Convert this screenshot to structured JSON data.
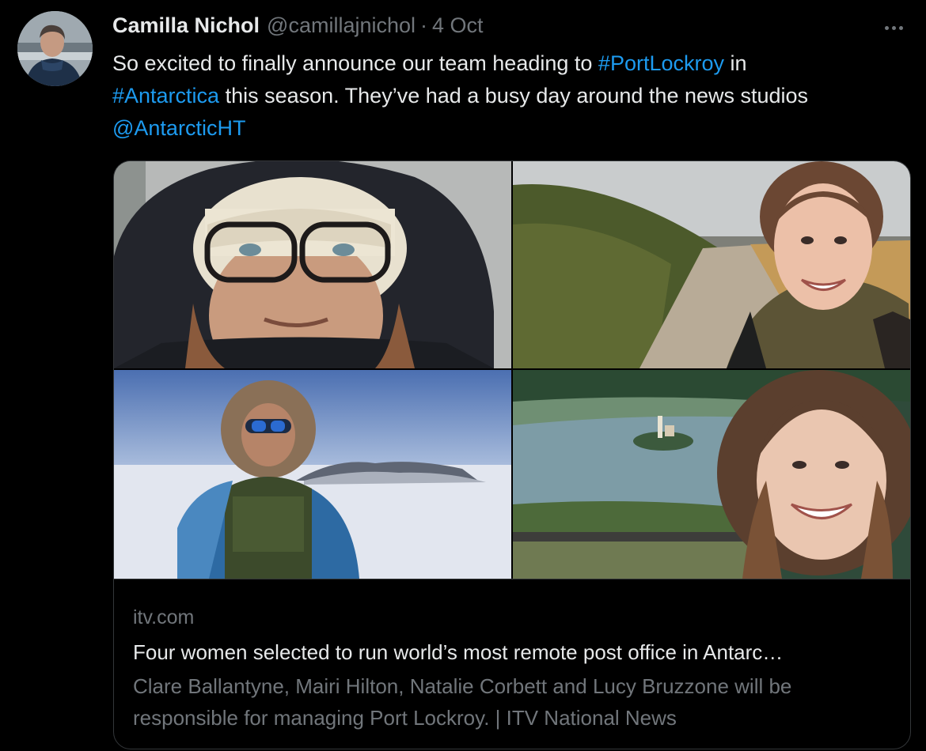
{
  "tweet": {
    "author_name": "Camilla Nichol",
    "author_handle": "@camillajnichol",
    "separator": "·",
    "date": "4 Oct",
    "text": {
      "t1": "So excited to finally announce our team heading to ",
      "hashtag1": "#PortLockroy",
      "t2": " in ",
      "hashtag2": "#Antarctica",
      "t3": " this season. They’ve had a busy day around the news studios ",
      "mention": "@AntarcticHT"
    }
  },
  "card": {
    "domain": "itv.com",
    "title": "Four women selected to run world’s most remote post office in Antarc…",
    "description": "Clare Ballantyne, Mairi Hilton, Natalie Corbett and Lucy Bruzzone will be responsible for managing Port Lockroy. | ITV National News"
  },
  "colors": {
    "background": "#000000",
    "text_primary": "#e7e9ea",
    "text_secondary": "#71767b",
    "link": "#1d9bf0",
    "border": "#333639"
  },
  "icons": {
    "more": "more-horizontal-icon"
  }
}
